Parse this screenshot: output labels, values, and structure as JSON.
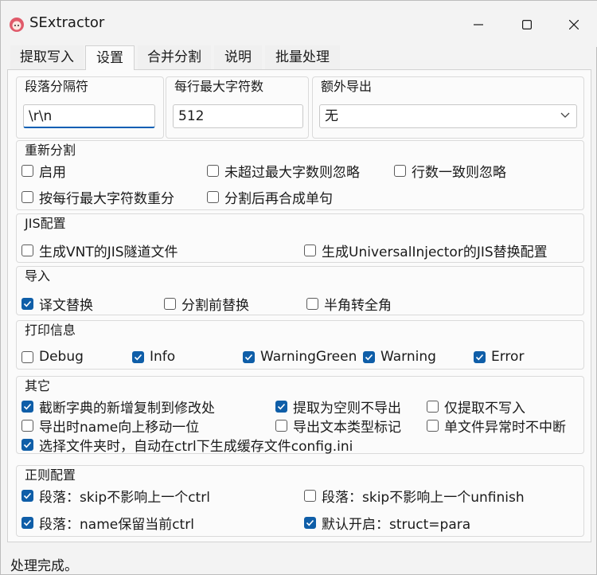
{
  "window": {
    "title": "SExtractor"
  },
  "tabs": [
    {
      "label": "提取写入"
    },
    {
      "label": "设置"
    },
    {
      "label": "合并分割"
    },
    {
      "label": "说明"
    },
    {
      "label": "批量处理"
    }
  ],
  "settings": {
    "separator": {
      "title": "段落分隔符",
      "value": "\\r\\n"
    },
    "max_chars": {
      "title": "每行最大字符数",
      "value": "512"
    },
    "extra_export": {
      "title": "额外导出",
      "selected": "无"
    },
    "resplit": {
      "title": "重新分割",
      "options": [
        {
          "label": "启用",
          "checked": false
        },
        {
          "label": "未超过最大字数则忽略",
          "checked": false
        },
        {
          "label": "行数一致则忽略",
          "checked": false
        },
        {
          "label": "按每行最大字符数重分",
          "checked": false
        },
        {
          "label": "分割后再合成单句",
          "checked": false
        }
      ]
    },
    "jis": {
      "title": "JIS配置",
      "options": [
        {
          "label": "生成VNT的JIS隧道文件",
          "checked": false
        },
        {
          "label": "生成UniversalInjector的JIS替换配置",
          "checked": false
        }
      ]
    },
    "import": {
      "title": "导入",
      "options": [
        {
          "label": "译文替换",
          "checked": true
        },
        {
          "label": "分割前替换",
          "checked": false
        },
        {
          "label": "半角转全角",
          "checked": false
        }
      ]
    },
    "print_info": {
      "title": "打印信息",
      "options": [
        {
          "label": "Debug",
          "checked": false
        },
        {
          "label": "Info",
          "checked": true
        },
        {
          "label": "WarningGreen",
          "checked": true
        },
        {
          "label": "Warning",
          "checked": true
        },
        {
          "label": "Error",
          "checked": true
        }
      ]
    },
    "other": {
      "title": "其它",
      "options": [
        {
          "label": "截断字典的新增复制到修改处",
          "checked": true
        },
        {
          "label": "提取为空则不导出",
          "checked": true
        },
        {
          "label": "仅提取不写入",
          "checked": false
        },
        {
          "label": "导出时name向上移动一位",
          "checked": false
        },
        {
          "label": "导出文本类型标记",
          "checked": false
        },
        {
          "label": "单文件异常时不中断",
          "checked": false
        },
        {
          "label": "选择文件夹时，自动在ctrl下生成缓存文件config.ini",
          "checked": true
        }
      ]
    },
    "regex": {
      "title": "正则配置",
      "options": [
        {
          "label": "段落：skip不影响上一个ctrl",
          "checked": true
        },
        {
          "label": "段落：skip不影响上一个unfinish",
          "checked": false
        },
        {
          "label": "段落：name保留当前ctrl",
          "checked": true
        },
        {
          "label": "默认开启：struct=para",
          "checked": true
        }
      ]
    }
  },
  "status": {
    "text": "处理完成。"
  },
  "colors": {
    "accent": "#0f5ea8",
    "focus_underline": "#0a5fb4"
  },
  "icons": {
    "app": "app-icon",
    "minimize": "minimize-icon",
    "maximize": "maximize-icon",
    "close": "close-icon"
  }
}
